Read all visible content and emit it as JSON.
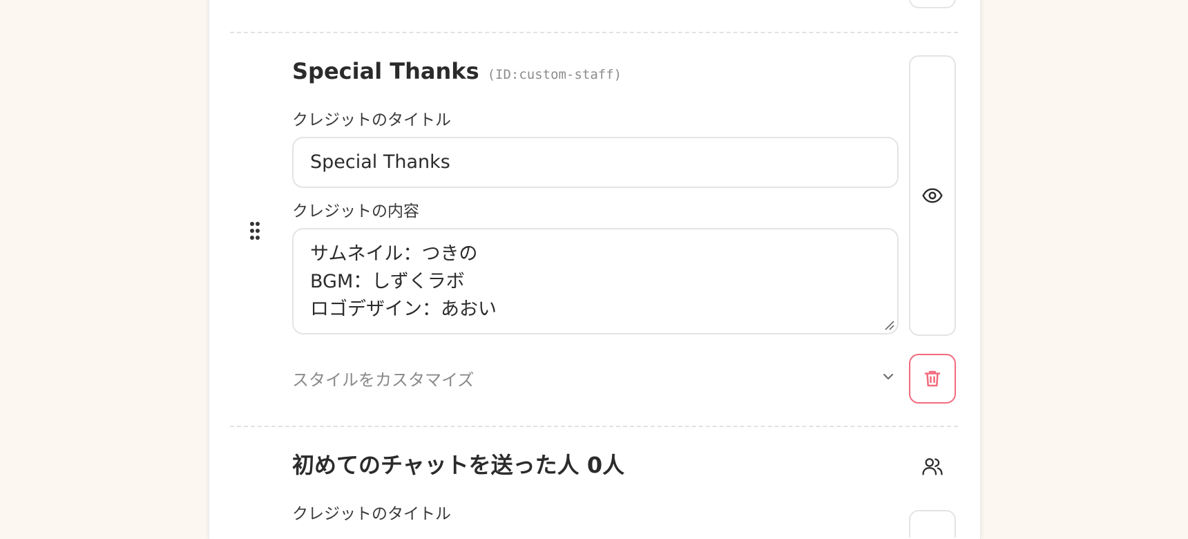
{
  "credit_items": [
    {
      "title": "Special Thanks",
      "id_tag": "(ID:custom-staff)",
      "title_field_label": "クレジットのタイトル",
      "title_value": "Special Thanks",
      "content_field_label": "クレジットの内容",
      "content_lines": [
        "サムネイル：つきの",
        "BGM：しずくラボ",
        "ロゴデザイン：あおい"
      ],
      "customize_label": "スタイルをカスタマイズ"
    },
    {
      "title": "初めてのチャットを送った人 0人",
      "title_field_label": "クレジットのタイトル"
    }
  ],
  "icons": {
    "drag": "drag-handle-icon",
    "visibility": "eye-icon",
    "delete": "trash-icon",
    "expand": "chevron-down-icon",
    "users": "users-icon"
  },
  "colors": {
    "page_background": "#fcf7f1",
    "danger": "#f26a7d",
    "border": "#e4e4e4"
  }
}
